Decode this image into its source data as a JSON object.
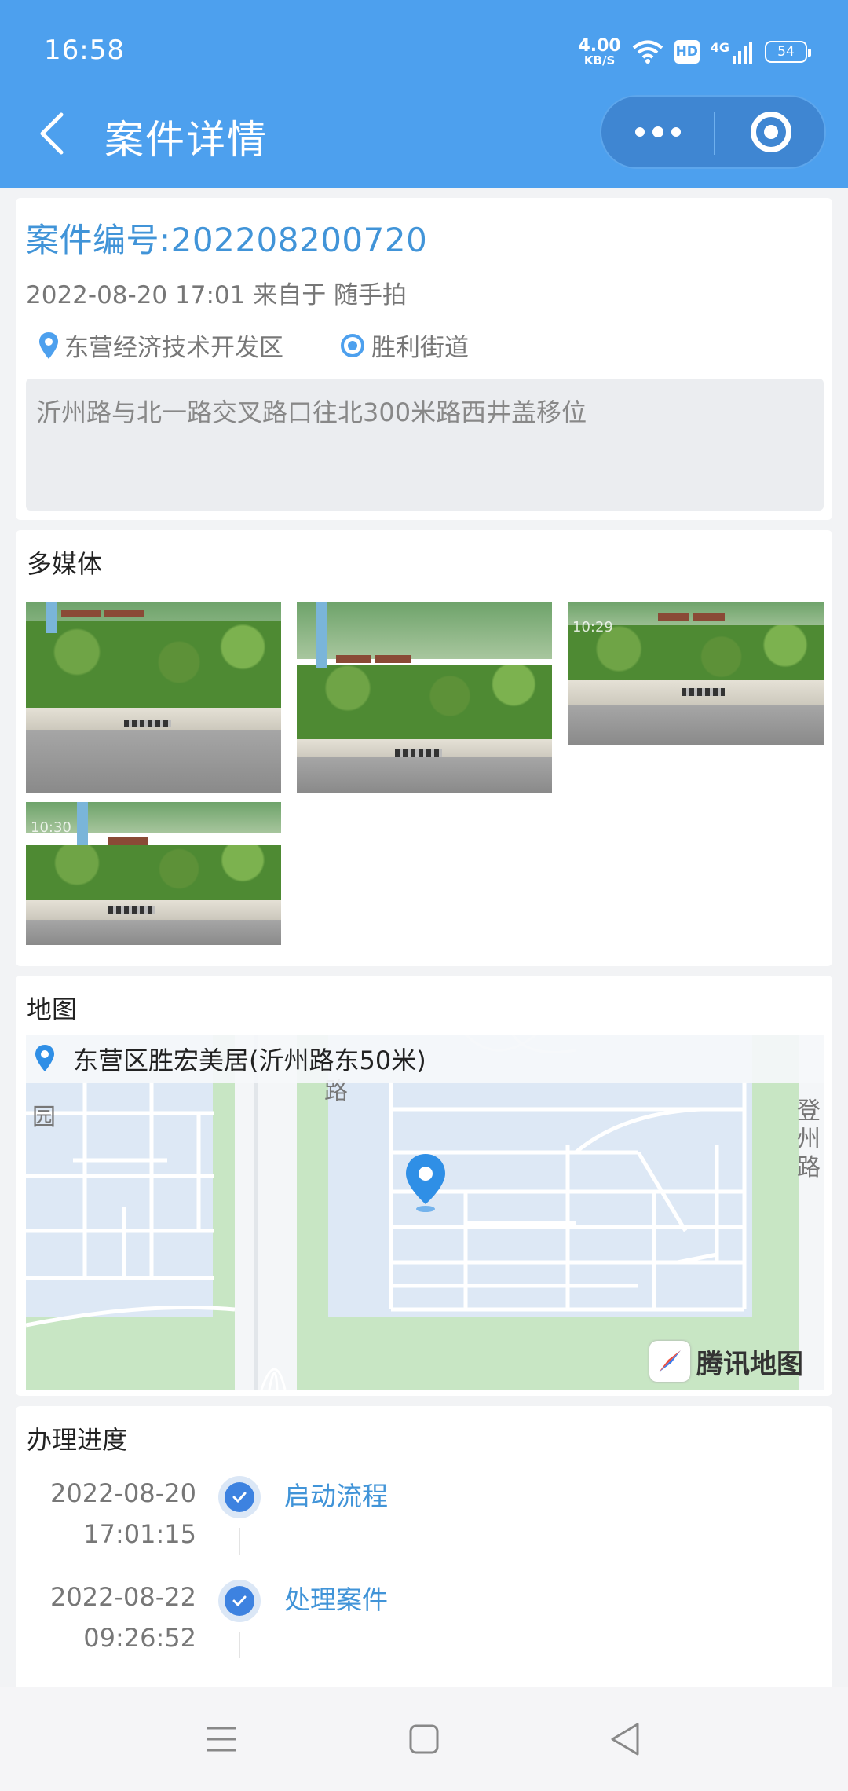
{
  "status_bar": {
    "time": "16:58",
    "net_speed_value": "4.00",
    "net_speed_unit": "KB/S",
    "hd_label": "HD",
    "network_label": "4G",
    "battery": "54"
  },
  "header": {
    "title": "案件详情",
    "background_color": "#4da0ee"
  },
  "case": {
    "number_label": "案件编号:202208200720",
    "meta": "2022-08-20 17:01 来自于 随手拍",
    "district": "东营经济技术开发区",
    "street": "胜利街道",
    "description": "沂州路与北一路交叉路口往北300米路西井盖移位",
    "accent_color": "#4194d8"
  },
  "media": {
    "title": "多媒体",
    "photos": [
      {
        "timestamp": ""
      },
      {
        "timestamp": ""
      },
      {
        "timestamp": "10:29"
      },
      {
        "timestamp": "10:30"
      }
    ]
  },
  "map": {
    "title": "地图",
    "address": "东营区胜宏美居(沂州路东50米)",
    "road_left": "路",
    "road_right": "登州路",
    "park_label": "园",
    "provider": "腾讯地图"
  },
  "progress": {
    "title": "办理进度",
    "steps": [
      {
        "date": "2022-08-20",
        "time": "17:01:15",
        "label": "启动流程"
      },
      {
        "date": "2022-08-22",
        "time": "09:26:52",
        "label": "处理案件"
      }
    ]
  },
  "nav_bar": {
    "icons": [
      "menu-icon",
      "home-icon",
      "back-triangle-icon"
    ]
  }
}
